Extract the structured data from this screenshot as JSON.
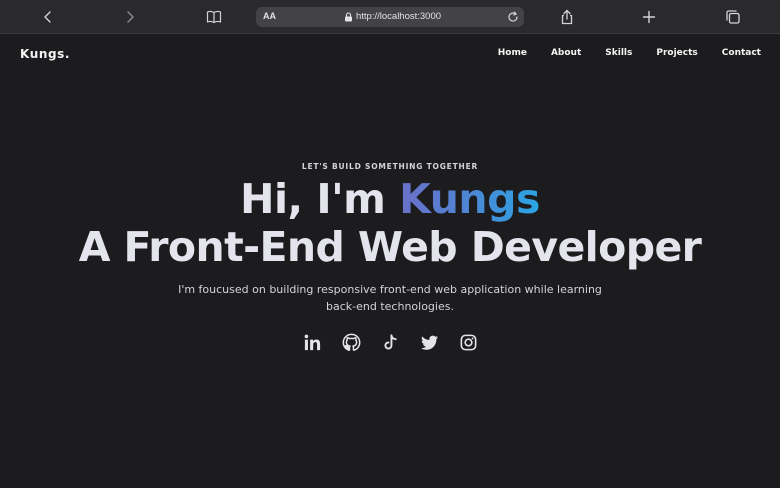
{
  "browser": {
    "aa_label": "AA",
    "url": "http://localhost:3000"
  },
  "site": {
    "brand": "Kungs.",
    "nav": [
      "Home",
      "About",
      "Skills",
      "Projects",
      "Contact"
    ]
  },
  "hero": {
    "eyebrow": "LET'S BUILD SOMETHING TOGETHER",
    "greeting_prefix": "Hi, I'm ",
    "name": "Kungs",
    "headline": "A Front-End Web Developer",
    "description": "I'm foucused on building responsive front-end web application while learning back-end technologies."
  },
  "socials": [
    "linkedin-icon",
    "github-icon",
    "tiktok-icon",
    "twitter-icon",
    "instagram-icon"
  ],
  "colors": {
    "background": "#1c1c1e",
    "toolbar": "#2a2a2c",
    "accent_start": "#6b70c8",
    "accent_end": "#2aa5e4",
    "text": "#e4e4ed"
  }
}
